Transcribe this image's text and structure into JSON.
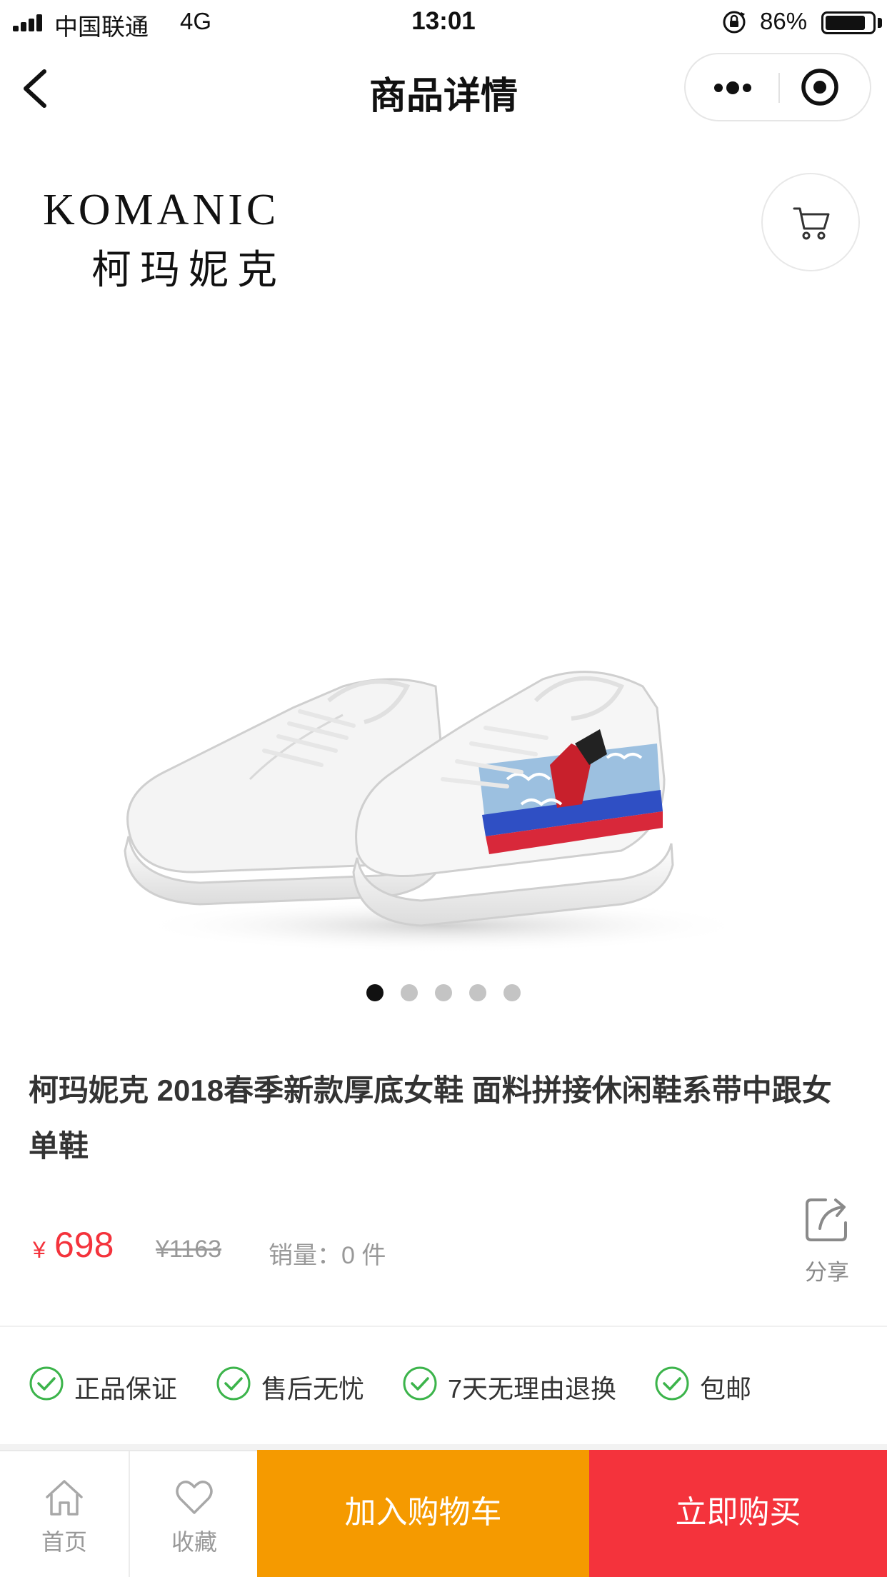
{
  "status_bar": {
    "carrier": "中国联通",
    "network": "4G",
    "time": "13:01",
    "battery_percent": "86%",
    "battery_level": 0.86
  },
  "nav": {
    "title": "商品详情",
    "back_icon": "chevron-left-icon",
    "more_icon": "more-dots-icon",
    "close_icon": "target-circle-icon"
  },
  "gallery": {
    "brand_en": "KOMANIC",
    "brand_cn": "柯玛妮克",
    "cart_icon": "shopping-cart-icon",
    "slide_count": 5,
    "active_slide": 1
  },
  "product": {
    "title": "柯玛妮克 2018春季新款厚底女鞋 面料拼接休闲鞋系带中跟女单鞋",
    "currency_symbol": "¥",
    "price": "698",
    "original_price": "¥1163",
    "sales": "销量：0 件",
    "share_label": "分享",
    "share_icon": "share-icon"
  },
  "guarantees": [
    {
      "label": "正品保证",
      "icon": "check-circle-icon"
    },
    {
      "label": "售后无忧",
      "icon": "check-circle-icon"
    },
    {
      "label": "7天无理由退换",
      "icon": "check-circle-icon"
    },
    {
      "label": "包邮",
      "icon": "check-circle-icon"
    }
  ],
  "bottom_bar": {
    "home_label": "首页",
    "home_icon": "home-icon",
    "favorite_label": "收藏",
    "favorite_icon": "heart-icon",
    "add_to_cart_label": "加入购物车",
    "buy_now_label": "立即购买"
  },
  "colors": {
    "price_red": "#f4333c",
    "cart_orange": "#f59a00",
    "buy_red": "#f4333c",
    "check_green": "#3cb44b"
  }
}
